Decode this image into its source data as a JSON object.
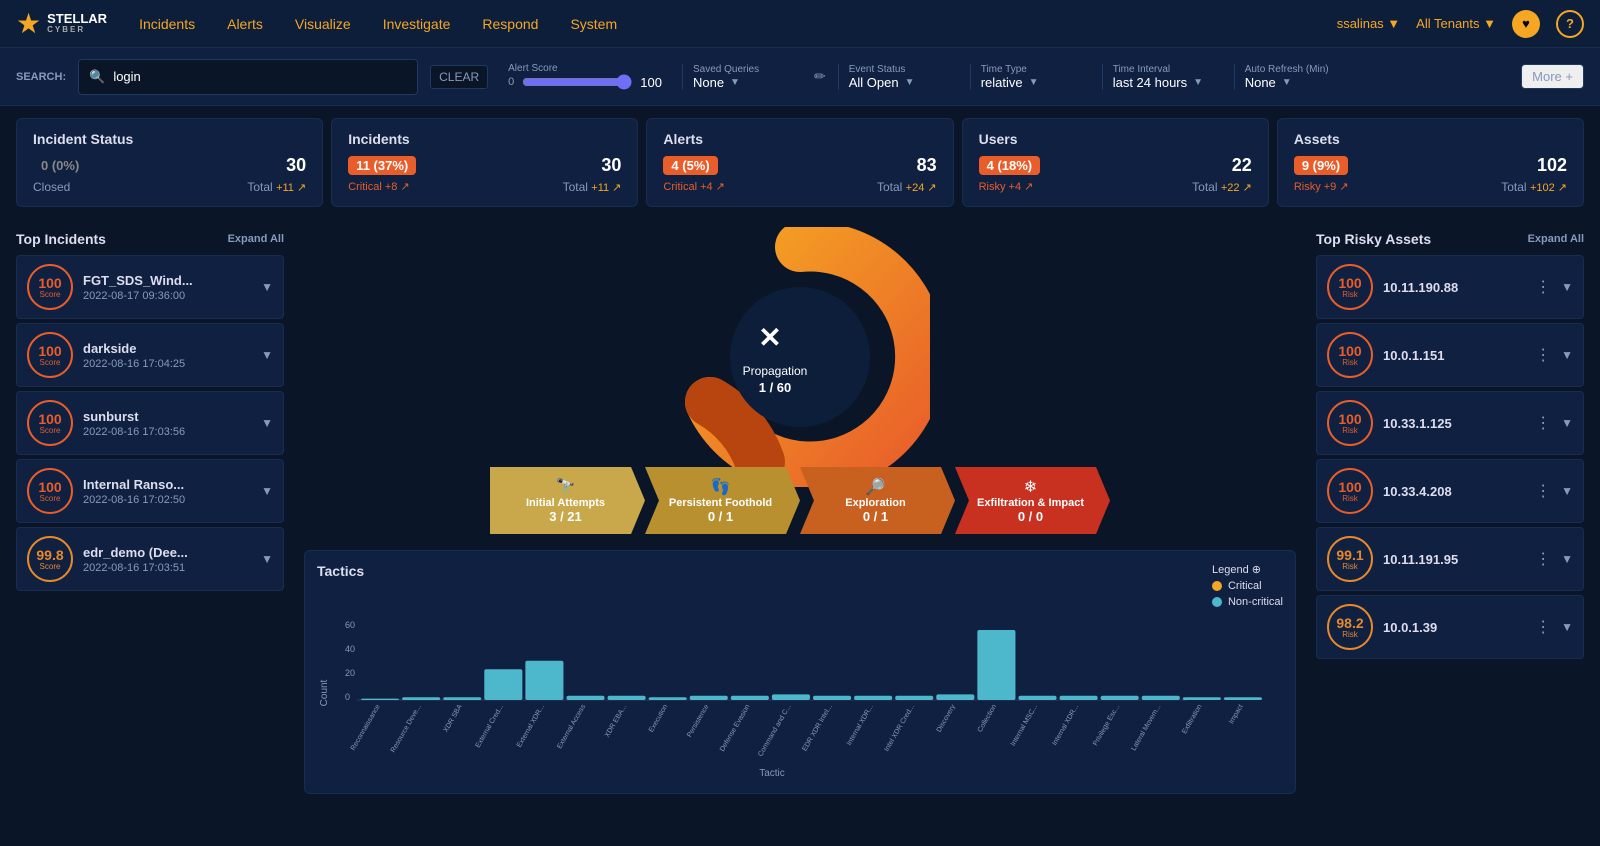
{
  "logo": {
    "star": "★",
    "name": "STELLAR",
    "sub_name": "CYBER",
    "trademark": "®"
  },
  "nav": {
    "links": [
      "Incidents",
      "Alerts",
      "Visualize",
      "Investigate",
      "Respond",
      "System"
    ],
    "user": "ssalinas ▼",
    "tenant": "All Tenants ▼",
    "help_icon": "?",
    "heart_icon": "♥"
  },
  "searchbar": {
    "search_label": "SEARCH:",
    "search_value": "login",
    "clear_label": "CLEAR",
    "alert_score_label": "Alert Score",
    "alert_score_min": "0",
    "alert_score_max": "100",
    "alert_score_value": "100",
    "saved_queries_label": "Saved Queries",
    "saved_queries_value": "None",
    "event_status_label": "Event Status",
    "event_status_value": "All Open",
    "time_type_label": "Time Type",
    "time_type_value": "relative",
    "time_interval_label": "Time Interval",
    "time_interval_value": "last 24 hours",
    "auto_refresh_label": "Auto Refresh (Min)",
    "auto_refresh_value": "None",
    "more_label": "More +"
  },
  "stat_cards": [
    {
      "title": "Incident Status",
      "badge": "0 (0%)",
      "badge_type": "transparent",
      "total": "30",
      "sub_left": "Closed",
      "sub_right_label": "Total",
      "sub_right_value": "+11 ↗"
    },
    {
      "title": "Incidents",
      "badge": "11 (37%)",
      "badge_type": "red",
      "total": "30",
      "sub_left": "Critical +8 ↗",
      "sub_right_label": "Total",
      "sub_right_value": "+11 ↗"
    },
    {
      "title": "Alerts",
      "badge": "4 (5%)",
      "badge_type": "red",
      "total": "83",
      "sub_left": "Critical +4 ↗",
      "sub_right_label": "Total",
      "sub_right_value": "+24 ↗"
    },
    {
      "title": "Users",
      "badge": "4 (18%)",
      "badge_type": "red",
      "total": "22",
      "sub_left": "Risky +4 ↗",
      "sub_right_label": "Total",
      "sub_right_value": "+22 ↗"
    },
    {
      "title": "Assets",
      "badge": "9 (9%)",
      "badge_type": "red",
      "total": "102",
      "sub_left": "Risky +9 ↗",
      "sub_right_label": "Total",
      "sub_right_value": "+102 ↗"
    }
  ],
  "top_incidents": {
    "title": "Top Incidents",
    "expand_all": "Expand All",
    "items": [
      {
        "score": "100",
        "name": "FGT_SDS_Wind...",
        "time": "2022-08-17 09:36:00"
      },
      {
        "score": "100",
        "name": "darkside",
        "time": "2022-08-16 17:04:25"
      },
      {
        "score": "100",
        "name": "sunburst",
        "time": "2022-08-16 17:03:56"
      },
      {
        "score": "100",
        "name": "Internal Ranso...",
        "time": "2022-08-16 17:02:50"
      },
      {
        "score": "99.8",
        "name": "edr_demo (Dee...",
        "time": "2022-08-16 17:03:51"
      }
    ]
  },
  "kill_chain": {
    "propagation_label": "Propagation",
    "propagation_value": "1 / 60"
  },
  "stages": [
    {
      "icon": "🔭",
      "name": "Initial Attempts",
      "count": "3 / 21",
      "color": "yellow"
    },
    {
      "icon": "👣",
      "name": "Persistent Foothold",
      "count": "0 / 1",
      "color": "yellow2"
    },
    {
      "icon": "🔍",
      "name": "Exploration",
      "count": "0 / 1",
      "color": "orange"
    },
    {
      "icon": "❄",
      "name": "Exfiltration & Impact",
      "count": "0 / 0",
      "color": "red"
    }
  ],
  "tactics": {
    "title": "Tactics",
    "y_label": "Count",
    "x_label": "Tactic",
    "legend": {
      "title": "Legend ⊕",
      "critical_label": "Critical",
      "non_critical_label": "Non-critical"
    },
    "bars": [
      {
        "label": "Reconnaissance",
        "critical": 0,
        "non_critical": 1
      },
      {
        "label": "Resource Deve...",
        "critical": 0,
        "non_critical": 2
      },
      {
        "label": "XDR SBA",
        "critical": 0,
        "non_critical": 2
      },
      {
        "label": "External Cred...",
        "critical": 0,
        "non_critical": 22
      },
      {
        "label": "External XDR...",
        "critical": 0,
        "non_critical": 28
      },
      {
        "label": "External Access",
        "critical": 0,
        "non_critical": 3
      },
      {
        "label": "XDR EBA...",
        "critical": 0,
        "non_critical": 3
      },
      {
        "label": "Execution",
        "critical": 0,
        "non_critical": 2
      },
      {
        "label": "Persistence",
        "critical": 0,
        "non_critical": 3
      },
      {
        "label": "Defense Evasion",
        "critical": 0,
        "non_critical": 3
      },
      {
        "label": "Command and C...",
        "critical": 0,
        "non_critical": 4
      },
      {
        "label": "EDR XDR Intel...",
        "critical": 0,
        "non_critical": 3
      },
      {
        "label": "Internal XDR...",
        "critical": 0,
        "non_critical": 3
      },
      {
        "label": "Intel XDR Cred...",
        "critical": 0,
        "non_critical": 3
      },
      {
        "label": "Discovery",
        "critical": 0,
        "non_critical": 4
      },
      {
        "label": "Collection",
        "critical": 0,
        "non_critical": 50
      },
      {
        "label": "Internal MSC...",
        "critical": 0,
        "non_critical": 3
      },
      {
        "label": "Internal XDR...",
        "critical": 0,
        "non_critical": 3
      },
      {
        "label": "Privilege Esc...",
        "critical": 0,
        "non_critical": 3
      },
      {
        "label": "Lateral Movem...",
        "critical": 0,
        "non_critical": 3
      },
      {
        "label": "Exfiltration",
        "critical": 0,
        "non_critical": 2
      },
      {
        "label": "Impact",
        "critical": 0,
        "non_critical": 2
      }
    ]
  },
  "top_risky_assets": {
    "title": "Top Risky Assets",
    "expand_all": "Expand All",
    "items": [
      {
        "score": "100",
        "name": "10.11.190.88"
      },
      {
        "score": "100",
        "name": "10.0.1.151"
      },
      {
        "score": "100",
        "name": "10.33.1.125"
      },
      {
        "score": "100",
        "name": "10.33.4.208"
      },
      {
        "score": "99.1",
        "name": "10.11.191.95"
      },
      {
        "score": "98.2",
        "name": "10.0.1.39"
      }
    ]
  }
}
